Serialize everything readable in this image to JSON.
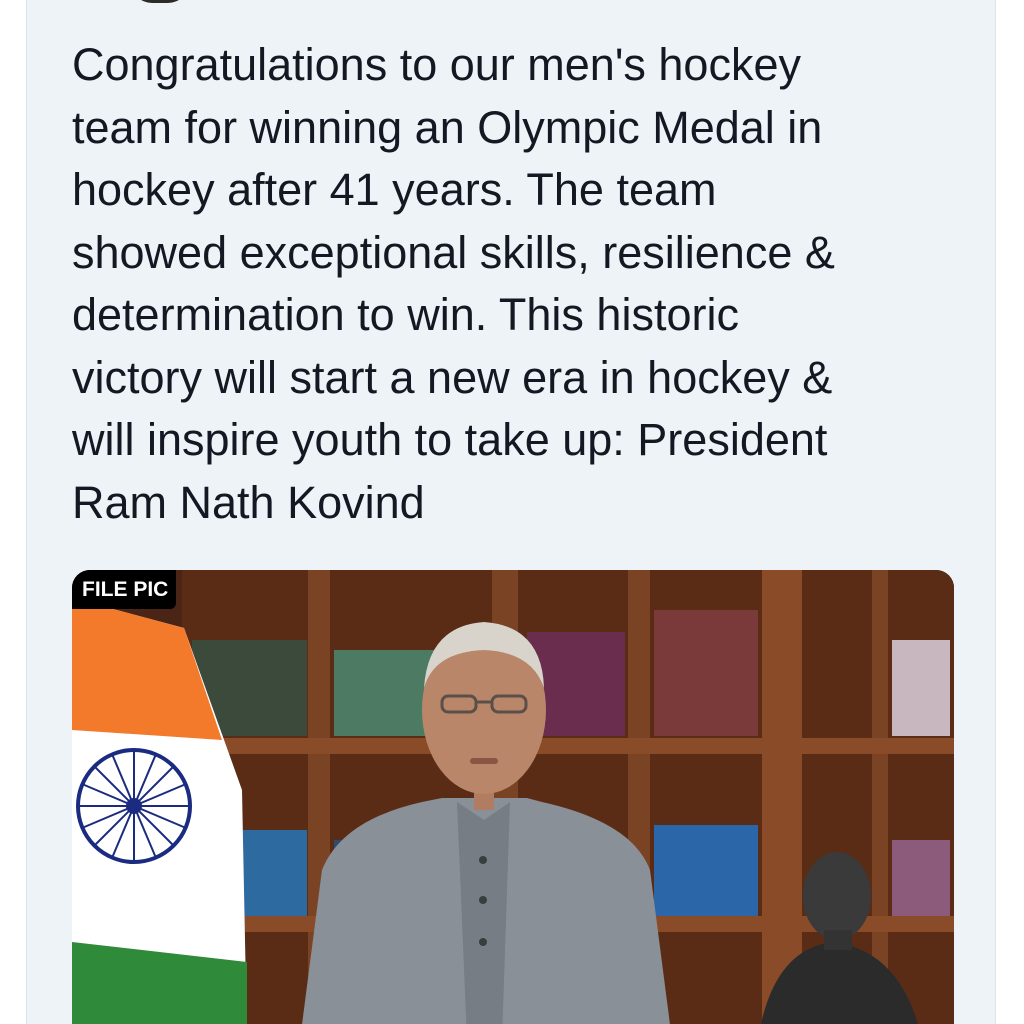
{
  "tweet": {
    "text_lines": [
      "Congratulations to our men's hockey",
      "team for winning an Olympic Medal in",
      "hockey after 41 years. The team",
      "showed exceptional skills, resilience &",
      "determination to win. This historic",
      "victory will start a new era in hockey &",
      "will inspire youth to take up: President",
      "Ram Nath Kovind"
    ]
  },
  "media": {
    "badge_label": "FILE PIC",
    "icon": "photo-icon"
  },
  "colors": {
    "card_background": "#eef3f7",
    "text": "#141823",
    "badge_background": "#000000",
    "flag_saffron": "#f27a2a",
    "flag_green": "#2f8a3a",
    "chakra_navy": "#1b2b80"
  }
}
